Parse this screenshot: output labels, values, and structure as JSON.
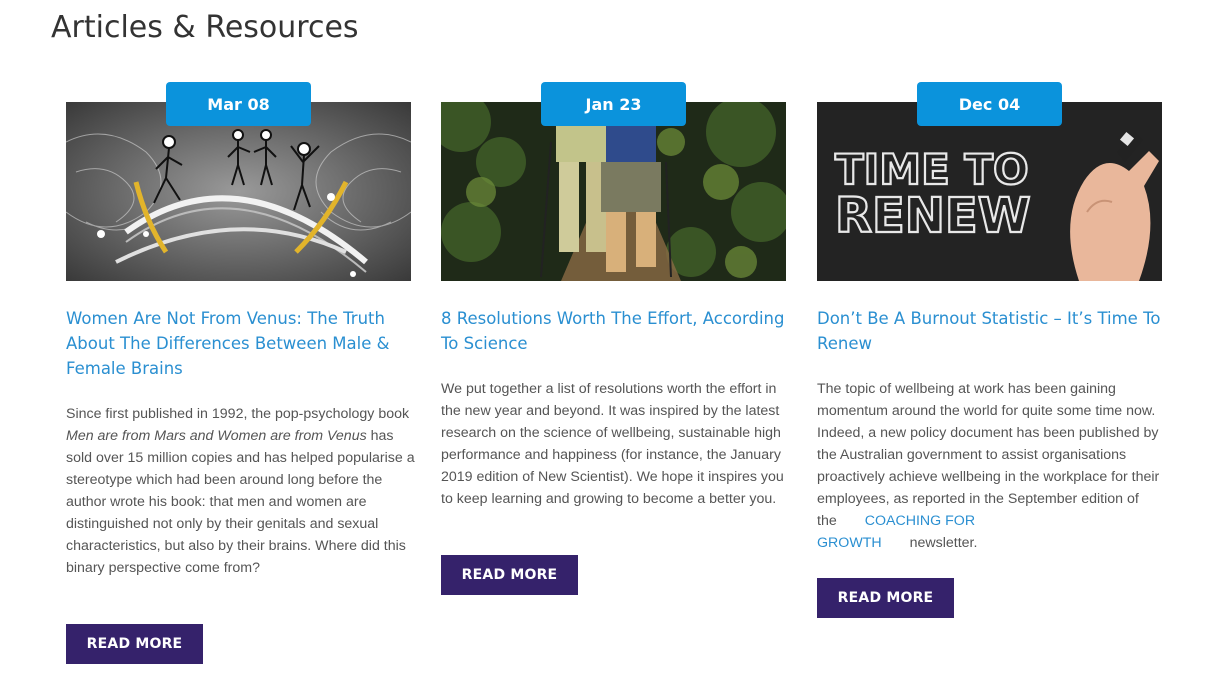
{
  "section": {
    "title": "Articles & Resources"
  },
  "articles": [
    {
      "date": "Mar 08",
      "image_icon": "brain-stick-figures-image",
      "title": "Women Are Not From Venus: The Truth About The Differences Between Male & Female Brains",
      "excerpt_before": "Since first published in 1992, the pop-psychology book ",
      "excerpt_em": "Men are from Mars and Women are from Venus",
      "excerpt_after": " has sold over 15 million copies and has helped popularise a stereotype which had been around long before the author wrote his book: that men and women are distinguished not only by their genitals and sexual characteristics, but also by their brains. Where did this binary perspective come from?",
      "button": "READ MORE"
    },
    {
      "date": "Jan 23",
      "image_icon": "hikers-forest-image",
      "title": "8 Resolutions Worth The Effort, According To Science",
      "excerpt": "We put together a list of resolutions worth the effort in the new year and beyond. It was inspired by the latest research on the science of wellbeing, sustainable high performance and happiness (for instance, the January 2019 edition of New Scientist). We hope it inspires you to keep learning and growing to become a better you.",
      "button": "READ MORE"
    },
    {
      "date": "Dec 04",
      "image_icon": "time-to-renew-image",
      "image_text_line1": "TIME TO",
      "image_text_line2": "RENEW",
      "title": "Don’t Be A Burnout Statistic – It’s Time To Renew",
      "excerpt_before": "The topic of wellbeing at work has been gaining momentum around the world for quite some time now. Indeed, a new policy document has been published by the Australian government to assist organisations proactively achieve wellbeing in the workplace for their employees, as reported in the September edition of the",
      "excerpt_link_1": "COACHING FOR",
      "excerpt_link_2": "GROWTH",
      "excerpt_after": "newsletter.",
      "button": "READ MORE"
    }
  ],
  "colors": {
    "badge": "#0b93dc",
    "title_link": "#2a8fd1",
    "button": "#35226b",
    "body_text": "#555555"
  }
}
